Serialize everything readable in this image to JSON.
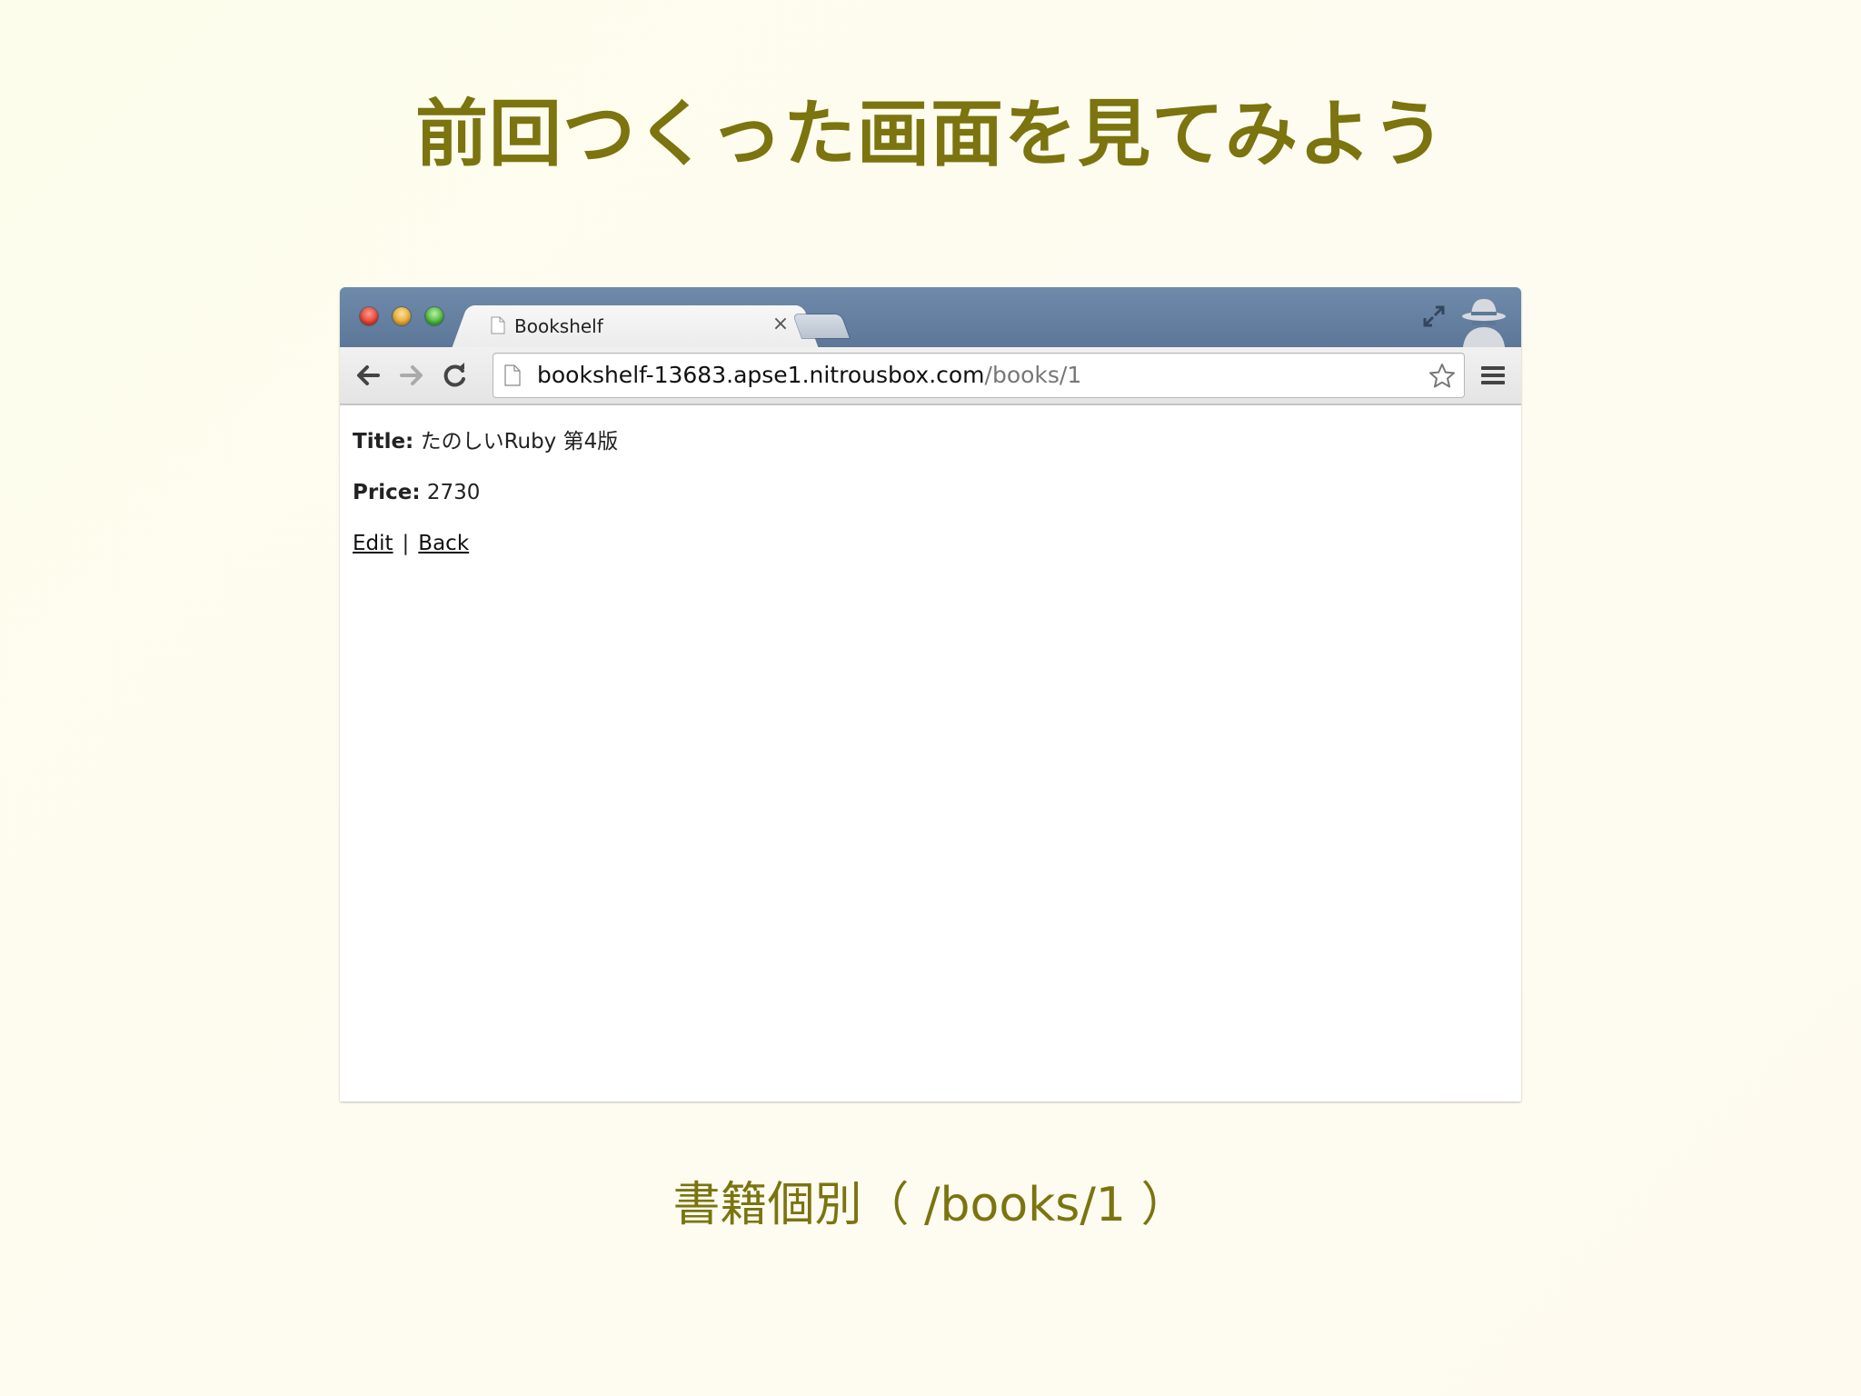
{
  "slide": {
    "title": "前回つくった画面を見てみよう",
    "caption": "書籍個別（ /books/1 ）"
  },
  "browser": {
    "tab_title": "Bookshelf",
    "tab_close": "×",
    "url_host": "bookshelf-13683.apse1.nitrousbox.com",
    "url_path": "/books/1"
  },
  "page": {
    "title_label": "Title:",
    "title_value": "たのしいRuby 第4版",
    "price_label": "Price:",
    "price_value": "2730",
    "edit_link": "Edit",
    "separator": "|",
    "back_link": "Back"
  },
  "colors": {
    "slide_text": "#7b740f",
    "titlebar": "#5c7797"
  },
  "icons": [
    "page-icon",
    "close-icon",
    "fullscreen-icon",
    "incognito-icon",
    "back-arrow-icon",
    "forward-arrow-icon",
    "reload-icon",
    "star-icon",
    "menu-icon"
  ]
}
